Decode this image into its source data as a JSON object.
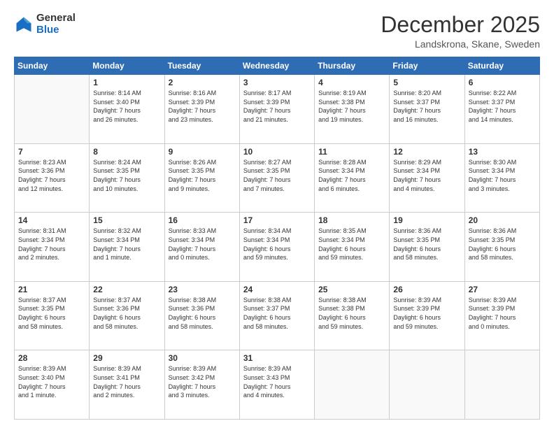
{
  "logo": {
    "general": "General",
    "blue": "Blue"
  },
  "header": {
    "month": "December 2025",
    "location": "Landskrona, Skane, Sweden"
  },
  "weekdays": [
    "Sunday",
    "Monday",
    "Tuesday",
    "Wednesday",
    "Thursday",
    "Friday",
    "Saturday"
  ],
  "weeks": [
    [
      {
        "day": "",
        "info": ""
      },
      {
        "day": "1",
        "info": "Sunrise: 8:14 AM\nSunset: 3:40 PM\nDaylight: 7 hours\nand 26 minutes."
      },
      {
        "day": "2",
        "info": "Sunrise: 8:16 AM\nSunset: 3:39 PM\nDaylight: 7 hours\nand 23 minutes."
      },
      {
        "day": "3",
        "info": "Sunrise: 8:17 AM\nSunset: 3:39 PM\nDaylight: 7 hours\nand 21 minutes."
      },
      {
        "day": "4",
        "info": "Sunrise: 8:19 AM\nSunset: 3:38 PM\nDaylight: 7 hours\nand 19 minutes."
      },
      {
        "day": "5",
        "info": "Sunrise: 8:20 AM\nSunset: 3:37 PM\nDaylight: 7 hours\nand 16 minutes."
      },
      {
        "day": "6",
        "info": "Sunrise: 8:22 AM\nSunset: 3:37 PM\nDaylight: 7 hours\nand 14 minutes."
      }
    ],
    [
      {
        "day": "7",
        "info": "Sunrise: 8:23 AM\nSunset: 3:36 PM\nDaylight: 7 hours\nand 12 minutes."
      },
      {
        "day": "8",
        "info": "Sunrise: 8:24 AM\nSunset: 3:35 PM\nDaylight: 7 hours\nand 10 minutes."
      },
      {
        "day": "9",
        "info": "Sunrise: 8:26 AM\nSunset: 3:35 PM\nDaylight: 7 hours\nand 9 minutes."
      },
      {
        "day": "10",
        "info": "Sunrise: 8:27 AM\nSunset: 3:35 PM\nDaylight: 7 hours\nand 7 minutes."
      },
      {
        "day": "11",
        "info": "Sunrise: 8:28 AM\nSunset: 3:34 PM\nDaylight: 7 hours\nand 6 minutes."
      },
      {
        "day": "12",
        "info": "Sunrise: 8:29 AM\nSunset: 3:34 PM\nDaylight: 7 hours\nand 4 minutes."
      },
      {
        "day": "13",
        "info": "Sunrise: 8:30 AM\nSunset: 3:34 PM\nDaylight: 7 hours\nand 3 minutes."
      }
    ],
    [
      {
        "day": "14",
        "info": "Sunrise: 8:31 AM\nSunset: 3:34 PM\nDaylight: 7 hours\nand 2 minutes."
      },
      {
        "day": "15",
        "info": "Sunrise: 8:32 AM\nSunset: 3:34 PM\nDaylight: 7 hours\nand 1 minute."
      },
      {
        "day": "16",
        "info": "Sunrise: 8:33 AM\nSunset: 3:34 PM\nDaylight: 7 hours\nand 0 minutes."
      },
      {
        "day": "17",
        "info": "Sunrise: 8:34 AM\nSunset: 3:34 PM\nDaylight: 6 hours\nand 59 minutes."
      },
      {
        "day": "18",
        "info": "Sunrise: 8:35 AM\nSunset: 3:34 PM\nDaylight: 6 hours\nand 59 minutes."
      },
      {
        "day": "19",
        "info": "Sunrise: 8:36 AM\nSunset: 3:35 PM\nDaylight: 6 hours\nand 58 minutes."
      },
      {
        "day": "20",
        "info": "Sunrise: 8:36 AM\nSunset: 3:35 PM\nDaylight: 6 hours\nand 58 minutes."
      }
    ],
    [
      {
        "day": "21",
        "info": "Sunrise: 8:37 AM\nSunset: 3:35 PM\nDaylight: 6 hours\nand 58 minutes."
      },
      {
        "day": "22",
        "info": "Sunrise: 8:37 AM\nSunset: 3:36 PM\nDaylight: 6 hours\nand 58 minutes."
      },
      {
        "day": "23",
        "info": "Sunrise: 8:38 AM\nSunset: 3:36 PM\nDaylight: 6 hours\nand 58 minutes."
      },
      {
        "day": "24",
        "info": "Sunrise: 8:38 AM\nSunset: 3:37 PM\nDaylight: 6 hours\nand 58 minutes."
      },
      {
        "day": "25",
        "info": "Sunrise: 8:38 AM\nSunset: 3:38 PM\nDaylight: 6 hours\nand 59 minutes."
      },
      {
        "day": "26",
        "info": "Sunrise: 8:39 AM\nSunset: 3:39 PM\nDaylight: 6 hours\nand 59 minutes."
      },
      {
        "day": "27",
        "info": "Sunrise: 8:39 AM\nSunset: 3:39 PM\nDaylight: 7 hours\nand 0 minutes."
      }
    ],
    [
      {
        "day": "28",
        "info": "Sunrise: 8:39 AM\nSunset: 3:40 PM\nDaylight: 7 hours\nand 1 minute."
      },
      {
        "day": "29",
        "info": "Sunrise: 8:39 AM\nSunset: 3:41 PM\nDaylight: 7 hours\nand 2 minutes."
      },
      {
        "day": "30",
        "info": "Sunrise: 8:39 AM\nSunset: 3:42 PM\nDaylight: 7 hours\nand 3 minutes."
      },
      {
        "day": "31",
        "info": "Sunrise: 8:39 AM\nSunset: 3:43 PM\nDaylight: 7 hours\nand 4 minutes."
      },
      {
        "day": "",
        "info": ""
      },
      {
        "day": "",
        "info": ""
      },
      {
        "day": "",
        "info": ""
      }
    ]
  ]
}
